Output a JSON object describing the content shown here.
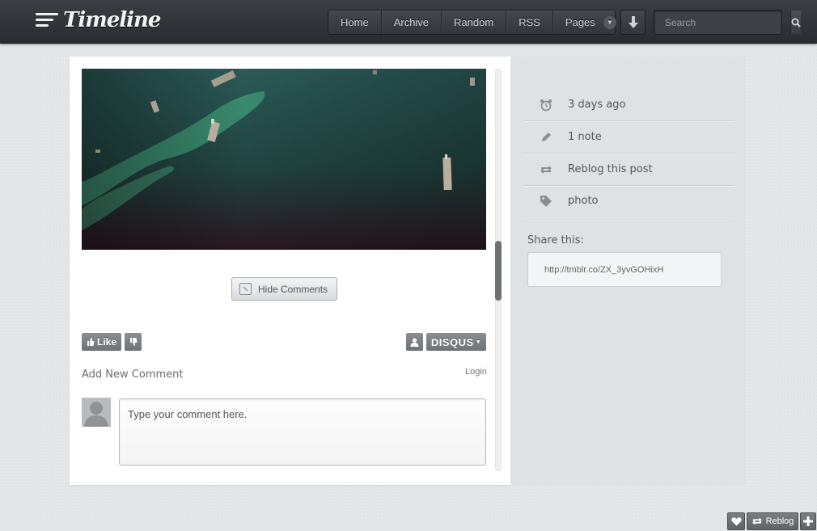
{
  "header": {
    "logo_text": "Timeline",
    "nav": [
      {
        "label": "Home"
      },
      {
        "label": "Archive"
      },
      {
        "label": "Random"
      },
      {
        "label": "RSS"
      },
      {
        "label": "Pages"
      }
    ],
    "search_placeholder": "Search"
  },
  "post": {
    "hide_comments_label": "Hide Comments"
  },
  "comments": {
    "like_label": "Like",
    "disqus_label": "DISQUS",
    "add_comment_label": "Add New Comment",
    "login_label": "Login",
    "comment_placeholder": "Type your comment here."
  },
  "sidebar": {
    "meta": [
      {
        "icon": "alarm-clock-icon",
        "text": "3 days ago"
      },
      {
        "icon": "pencil-icon",
        "text": "1 note"
      },
      {
        "icon": "reblog-icon",
        "text": "Reblog this post"
      },
      {
        "icon": "tag-icon",
        "text": "photo"
      }
    ],
    "share_label": "Share this:",
    "share_url": "http://tmblr.co/ZX_3yvGOHixH"
  },
  "tumblr_controls": {
    "reblog_label": "Reblog"
  }
}
